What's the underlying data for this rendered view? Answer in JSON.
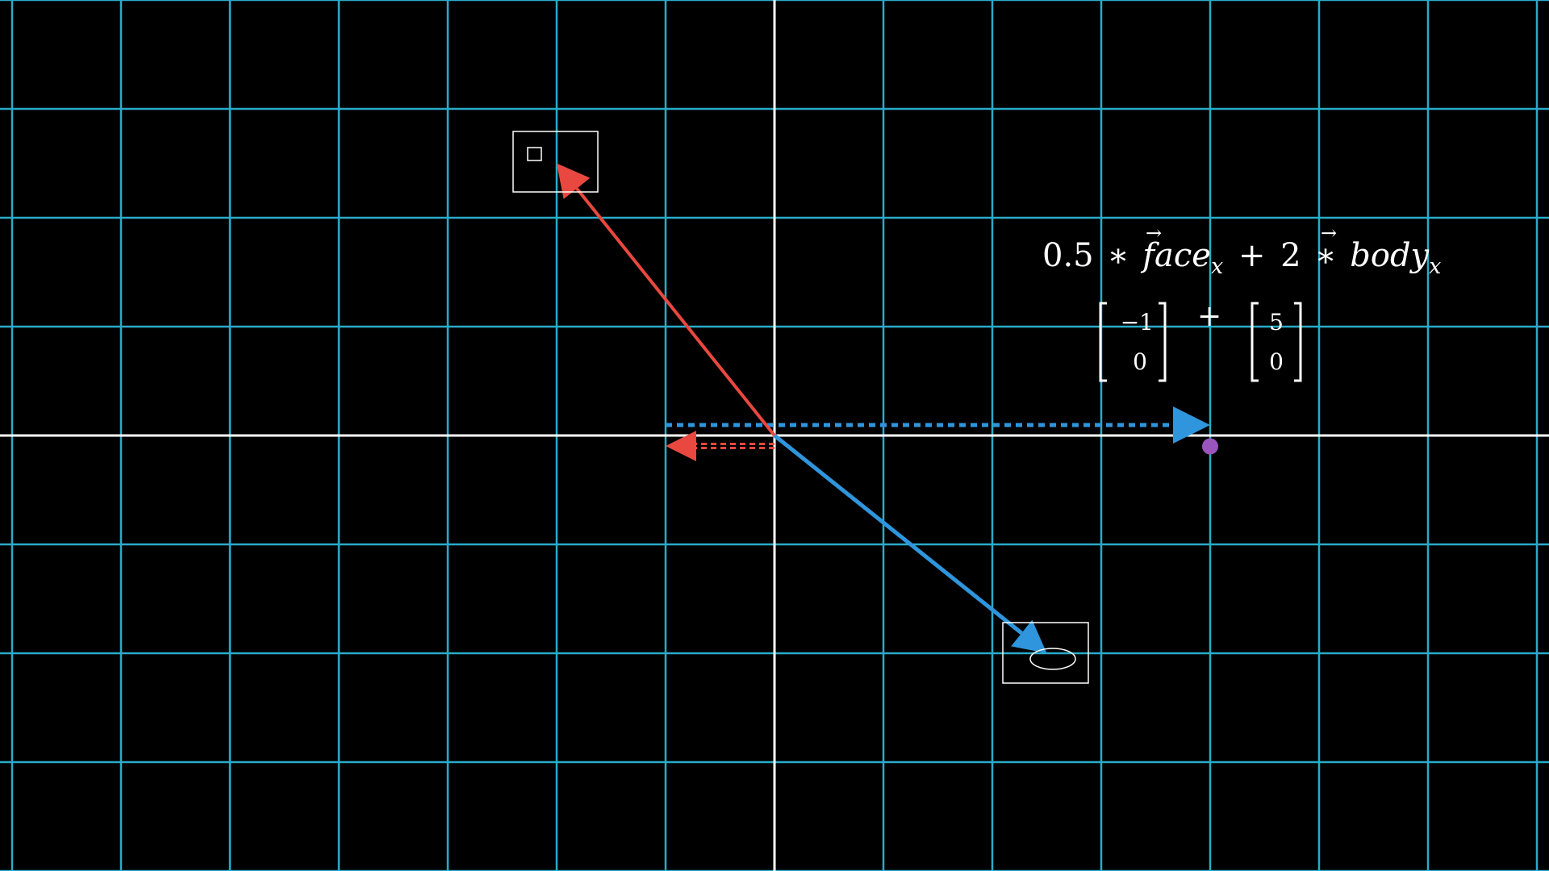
{
  "colors": {
    "background": "#000000",
    "grid": "#29abca",
    "axis": "#ffffff",
    "face_vector": "#e8483f",
    "body_vector": "#2f95dc",
    "sum_point": "#9a55bd",
    "box": "#ffffff"
  },
  "plane": {
    "x_range": [
      -7,
      7
    ],
    "y_range": [
      -4,
      4
    ]
  },
  "vectors": {
    "face": {
      "tip": [
        -2,
        2.5
      ]
    },
    "body": {
      "tip": [
        2.5,
        -2
      ]
    },
    "face_scaled_x": {
      "tip": [
        -1,
        0
      ]
    },
    "body_scaled_x": {
      "tip": [
        4,
        0
      ]
    }
  },
  "sum_point": {
    "at": [
      4,
      -0.1
    ]
  },
  "icons": {
    "face_box": "square-icon",
    "body_box": "ellipse-icon"
  },
  "equation": {
    "coef1": "0.5",
    "times": "∗",
    "face_word": "face",
    "subscript": "x",
    "plus": "+",
    "coef2": "2",
    "body_word": "body",
    "arrow": "→"
  },
  "matrices": {
    "left": [
      "−1",
      "0"
    ],
    "plus": "+",
    "right": [
      "5",
      "0"
    ]
  }
}
